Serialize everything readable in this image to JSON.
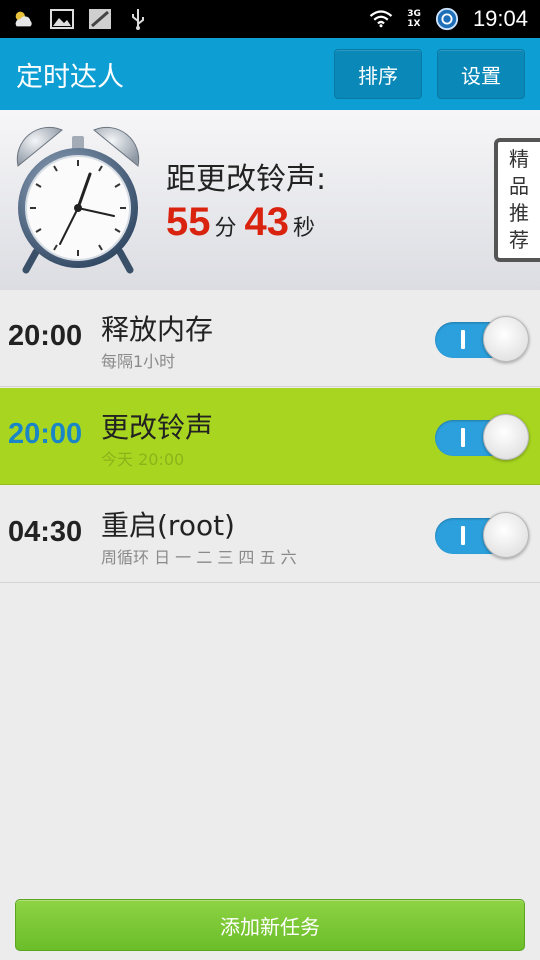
{
  "status_bar": {
    "network_top": "3G",
    "network_bottom": "1X",
    "time": "19:04"
  },
  "app_bar": {
    "title": "定时达人",
    "sort_label": "排序",
    "settings_label": "设置"
  },
  "header": {
    "countdown_label": "距更改铃声:",
    "minutes": "55",
    "minutes_unit": "分",
    "seconds": "43",
    "seconds_unit": "秒",
    "recommend_chars": [
      "精",
      "品",
      "推",
      "荐"
    ]
  },
  "tasks": [
    {
      "time": "20:00",
      "title": "释放内存",
      "subtitle": "每隔1小时",
      "enabled": true,
      "highlighted": false
    },
    {
      "time": "20:00",
      "title": "更改铃声",
      "subtitle": "今天 20:00",
      "enabled": true,
      "highlighted": true
    },
    {
      "time": "04:30",
      "title": "重启(root)",
      "subtitle": "周循环 日 一 二 三 四 五 六",
      "enabled": true,
      "highlighted": false
    }
  ],
  "add_task_label": "添加新任务",
  "colors": {
    "app_bar": "#0d9fd4",
    "highlight_row": "#a8d620",
    "countdown": "#d9230f",
    "toggle_on": "#2ca0dd",
    "add_button": "#7cc736"
  }
}
